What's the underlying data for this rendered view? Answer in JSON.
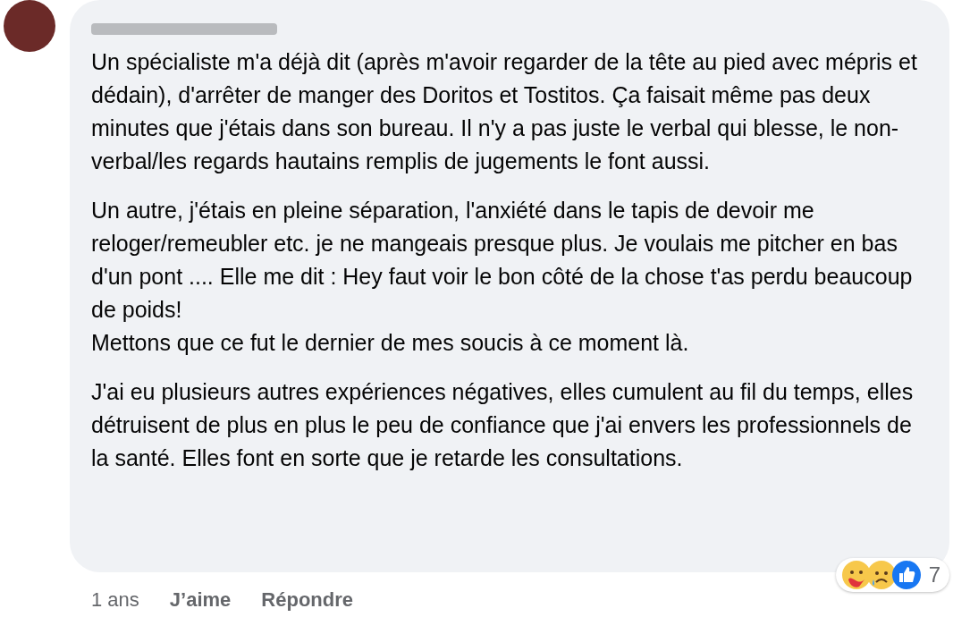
{
  "comment": {
    "paragraphs": [
      "Un spécialiste m'a déjà dit (après m'avoir regarder de la tête au pied avec mépris et dédain), d'arrêter de manger des Doritos et Tostitos. Ça faisait même pas deux minutes que j'étais dans son bureau. Il n'y a pas juste le verbal qui blesse, le non-verbal/les regards hautains remplis de jugements le font aussi.",
      "Un autre, j'étais en pleine séparation, l'anxiété dans le tapis de devoir me reloger/remeubler etc. je ne mangeais presque plus. Je voulais me pitcher en bas d'un pont .... Elle me dit : Hey faut voir le bon côté de la chose t'as perdu beaucoup de poids!\nMettons que ce fut le dernier de mes soucis à ce moment là.",
      "J'ai eu plusieurs autres expériences négatives, elles cumulent au fil du temps, elles détruisent de plus en plus le peu de confiance que j'ai envers les professionnels de la santé. Elles font en sorte que je retarde les consultations."
    ],
    "reaction_count": "7"
  },
  "footer": {
    "time": "1 ans",
    "actions": [
      "J’aime",
      "Répondre"
    ]
  }
}
